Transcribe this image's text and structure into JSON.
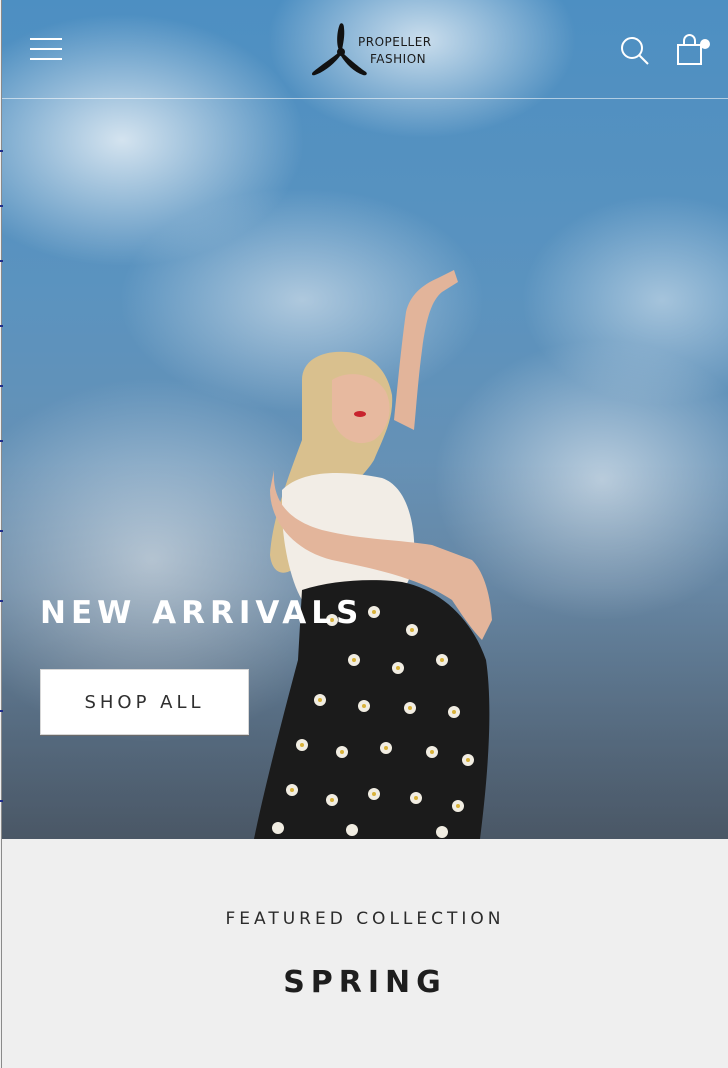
{
  "header": {
    "menu_icon": "hamburger-menu-icon",
    "logo": {
      "line1": "PROPELLER",
      "line2": "FASHION",
      "icon": "propeller-icon"
    },
    "search_icon": "search-icon",
    "cart_icon": "shopping-bag-icon"
  },
  "hero": {
    "title": "NEW ARRIVALS",
    "cta_label": "SHOP ALL"
  },
  "featured": {
    "eyebrow": "FEATURED COLLECTION",
    "title": "SPRING"
  },
  "colors": {
    "sky": "#5b93bf",
    "text_dark": "#1e1e1e",
    "section_bg": "#efefef",
    "white": "#ffffff"
  }
}
